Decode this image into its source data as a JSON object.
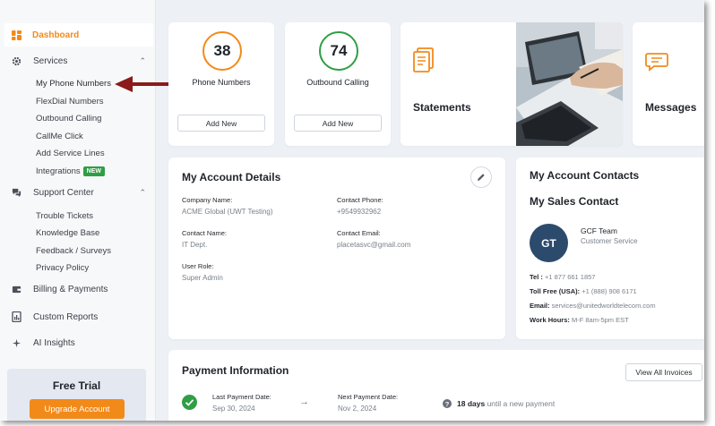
{
  "sidebar": {
    "dashboard": "Dashboard",
    "services": {
      "label": "Services",
      "items": [
        "My Phone Numbers",
        "FlexDial Numbers",
        "Outbound Calling",
        "CallMe Click",
        "Add Service Lines",
        "Integrations"
      ],
      "integrations_badge": "NEW"
    },
    "support": {
      "label": "Support Center",
      "items": [
        "Trouble Tickets",
        "Knowledge Base",
        "Feedback / Surveys",
        "Privacy Policy"
      ]
    },
    "billing": "Billing & Payments",
    "reports": "Custom Reports",
    "ai": "AI Insights",
    "trial": {
      "title": "Free Trial",
      "button": "Upgrade Account"
    }
  },
  "stats": [
    {
      "value": "38",
      "label": "Phone Numbers",
      "button": "Add New",
      "color": "#f28a1a"
    },
    {
      "value": "74",
      "label": "Outbound Calling",
      "button": "Add New",
      "color": "#2f9e44"
    }
  ],
  "tiles": {
    "statements": "Statements",
    "messages": "Messages"
  },
  "account": {
    "title": "My Account Details",
    "company_label": "Company Name:",
    "company": "ACME Global (UWT Testing)",
    "phone_label": "Contact Phone:",
    "phone": "+9549932962",
    "contact_label": "Contact Name:",
    "contact": "IT Dept.",
    "email_label": "Contact Email:",
    "email": "placetasvc@gmail.com",
    "role_label": "User Role:",
    "role": "Super Admin"
  },
  "contacts": {
    "title": "My Account Contacts",
    "subtitle": "My Sales Contact",
    "initials": "GT",
    "name": "GCF Team",
    "role": "Customer Service",
    "tel_label": "Tel :",
    "tel": "+1 877 661 1857",
    "tollfree_label": "Toll Free (USA):",
    "tollfree": "+1 (888) 908 6171",
    "email_label": "Email:",
    "email": "services@unitedworldtelecom.com",
    "hours_label": "Work Hours:",
    "hours": "M-F 8am-5pm EST"
  },
  "payment": {
    "title": "Payment Information",
    "view_all": "View All Invoices",
    "last_label": "Last Payment Date:",
    "last": "Sep 30, 2024",
    "next_label": "Next Payment Date:",
    "next": "Nov 2, 2024",
    "days": "18 days",
    "days_suffix": "until a new payment"
  },
  "colors": {
    "accent": "#f28a1a",
    "green": "#2f9e44",
    "arrow": "#8b1a1a",
    "avatar": "#2c4a6b"
  }
}
